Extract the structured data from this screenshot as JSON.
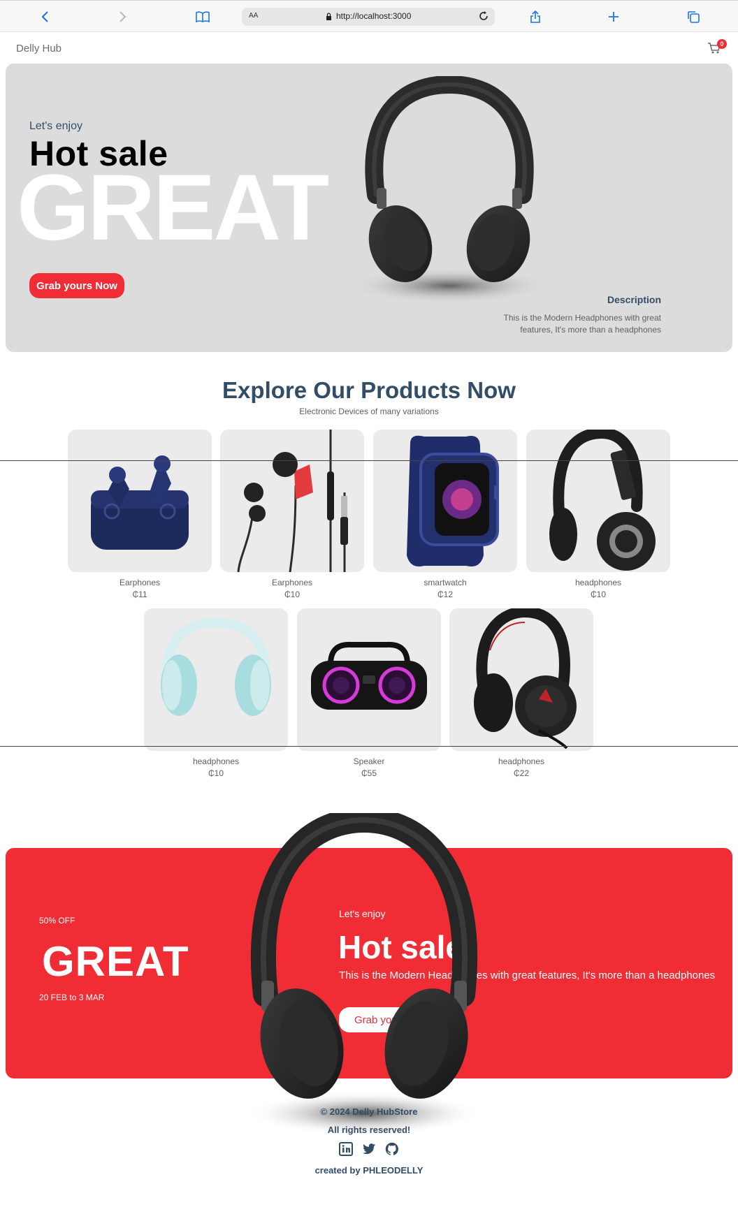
{
  "browser": {
    "aa_label": "AA",
    "url": "http://localhost:3000"
  },
  "navbar": {
    "logo": "Delly Hub",
    "cart_qty": "0"
  },
  "hero": {
    "small_text": "Let's enjoy",
    "mid_text": "Hot sale",
    "large_text": "GREAT",
    "button_text": "Grab yours Now",
    "desc_title": "Description",
    "desc_text": "This is the Modern Headphones with great features, It's more than a headphones"
  },
  "products_heading": {
    "title": "Explore Our Products Now",
    "subtitle": "Electronic Devices of many variations"
  },
  "products": [
    {
      "name": "Earphones",
      "price": "₵11",
      "icon": "earbuds-case-icon"
    },
    {
      "name": "Earphones",
      "price": "₵10",
      "icon": "wired-earphones-icon"
    },
    {
      "name": "smartwatch",
      "price": "₵12",
      "icon": "smartwatch-icon"
    },
    {
      "name": "headphones",
      "price": "₵10",
      "icon": "headphones-icon"
    },
    {
      "name": "headphones",
      "price": "₵10",
      "icon": "headphones-icon"
    },
    {
      "name": "Speaker",
      "price": "₵55",
      "icon": "speaker-icon"
    },
    {
      "name": "headphones",
      "price": "₵22",
      "icon": "headset-icon"
    }
  ],
  "banner": {
    "discount": "50% OFF",
    "large_text": "GREAT",
    "sale_time": "20 FEB to 3 MAR",
    "small_text": "Let's enjoy",
    "mid_text": "Hot sale",
    "desc": "This is the Modern Headphones with great features, It's more than a headphones",
    "button_text": "Grab yours Now"
  },
  "footer": {
    "copyright": "© 2024 Delly HubStore",
    "rights": "All rights reserved!",
    "credit": "created by PHLEODELLY"
  },
  "colors": {
    "accent": "#f02d34",
    "heading": "#324d67",
    "hero_bg": "#dcdcdc",
    "card_bg": "#ebebeb"
  }
}
